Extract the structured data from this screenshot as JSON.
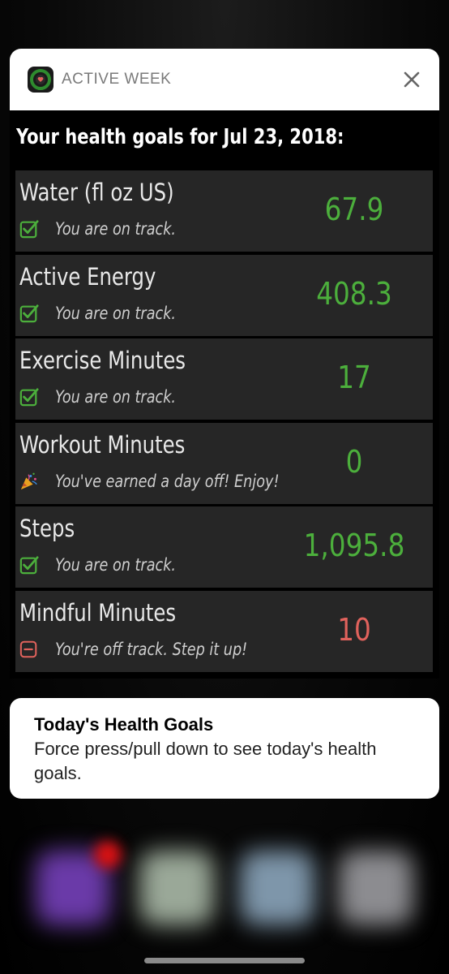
{
  "header": {
    "app_name": "ACTIVE WEEK",
    "close_icon": "close-icon"
  },
  "panel": {
    "title": "Your health goals for Jul 23, 2018:",
    "goals": [
      {
        "name": "Water (fl oz US)",
        "status_text": "You are on track.",
        "status_icon": "checkbox-check-icon",
        "value": "67.9",
        "value_color": "#4caf3c"
      },
      {
        "name": "Active Energy",
        "status_text": "You are on track.",
        "status_icon": "checkbox-check-icon",
        "value": "408.3",
        "value_color": "#4caf3c"
      },
      {
        "name": "Exercise Minutes",
        "status_text": "You are on track.",
        "status_icon": "checkbox-check-icon",
        "value": "17",
        "value_color": "#4caf3c"
      },
      {
        "name": "Workout Minutes",
        "status_text": "You've earned a day off! Enjoy!",
        "status_icon": "party-popper-icon",
        "value": "0",
        "value_color": "#4caf3c"
      },
      {
        "name": "Steps",
        "status_text": "You are on track.",
        "status_icon": "checkbox-check-icon",
        "value": "1,095.8",
        "value_color": "#4caf3c"
      },
      {
        "name": "Mindful Minutes",
        "status_text": "You're off track.  Step it up!",
        "status_icon": "checkbox-minus-icon",
        "value": "10",
        "value_color": "#e0625c"
      }
    ]
  },
  "notification": {
    "title": "Today's Health Goals",
    "body": "Force press/pull down to see today's health goals."
  },
  "colors": {
    "on_track": "#4caf3c",
    "off_track": "#e0625c",
    "row_bg": "#262626"
  }
}
